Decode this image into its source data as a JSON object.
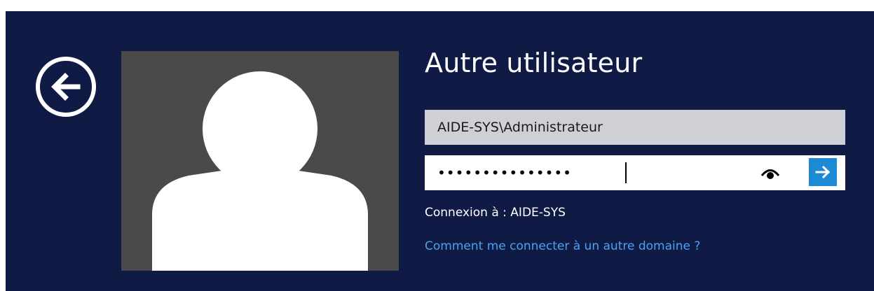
{
  "login": {
    "title": "Autre utilisateur",
    "username_value": "AIDE-SYS\\Administrateur",
    "password_mask": "•••••••••••••••",
    "connect_to": "Connexion à : AIDE-SYS",
    "other_domain_link": "Comment me connecter à un autre domaine ?",
    "icons": {
      "back": "back-arrow-icon",
      "avatar": "user-silhouette-icon",
      "reveal": "eye-icon",
      "submit": "arrow-right-icon"
    },
    "colors": {
      "background": "#0f1b45",
      "avatar_bg": "#4a4a4a",
      "username_field": "#ced0d6",
      "submit_button": "#1e8ad6",
      "link": "#4aa3f0"
    }
  }
}
